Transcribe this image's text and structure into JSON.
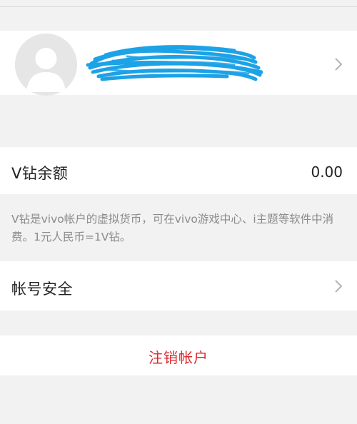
{
  "profile": {
    "avatar_icon": "default-user-avatar-icon",
    "name_redaction_color": "#1ca2e6",
    "chevron_icon": "chevron-right-icon"
  },
  "balance": {
    "label": "V钻余额",
    "value": "0.00"
  },
  "description": "V钻是vivo帐户的虚拟货币，可在vivo游戏中心、i主题等软件中消费。1元人民币=1V钻。",
  "security": {
    "label": "帐号安全",
    "chevron_icon": "chevron-right-icon"
  },
  "logout": {
    "label": "注销帐户",
    "color": "#e0262a"
  }
}
